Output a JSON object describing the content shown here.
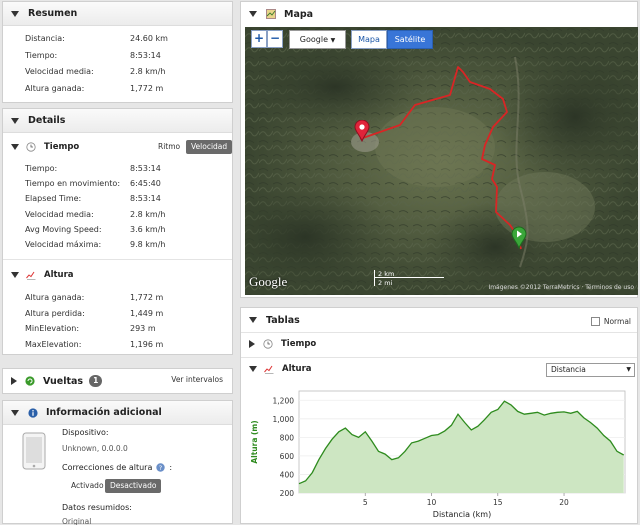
{
  "summary": {
    "title": "Resumen",
    "rows": [
      {
        "label": "Distancia:",
        "value": "24.60 km"
      },
      {
        "label": "Tiempo:",
        "value": "8:53:14"
      },
      {
        "label": "Velocidad media:",
        "value": "2.8 km/h"
      },
      {
        "label": "Altura ganada:",
        "value": "1,772 m"
      }
    ]
  },
  "details": {
    "title": "Details",
    "time_section": {
      "title": "Tiempo",
      "toggle_pace": "Ritmo",
      "toggle_speed": "Velocidad",
      "rows": [
        {
          "label": "Tiempo:",
          "value": "8:53:14"
        },
        {
          "label": "Tiempo en movimiento:",
          "value": "6:45:40"
        },
        {
          "label": "Elapsed Time:",
          "value": "8:53:14"
        },
        {
          "label": "Velocidad media:",
          "value": "2.8 km/h"
        },
        {
          "label": "Avg Moving Speed:",
          "value": "3.6 km/h"
        },
        {
          "label": "Velocidad máxima:",
          "value": "9.8 km/h"
        }
      ]
    },
    "altitude_section": {
      "title": "Altura",
      "rows": [
        {
          "label": "Altura ganada:",
          "value": "1,772 m"
        },
        {
          "label": "Altura perdida:",
          "value": "1,449 m"
        },
        {
          "label": "MinElevation:",
          "value": "293 m"
        },
        {
          "label": "MaxElevation:",
          "value": "1,196 m"
        }
      ]
    }
  },
  "laps": {
    "title": "Vueltas",
    "count": "1",
    "link": "Ver intervalos"
  },
  "extra": {
    "title": "Información adicional",
    "device_label": "Dispositivo:",
    "device_value": "Unknown, 0.0.0.0",
    "corrections_label": "Correcciones de altura",
    "corrections_suffix": ":",
    "toggle_on": "Activado",
    "toggle_off": "Desactivado",
    "summary_label": "Datos resumidos:",
    "summary_value": "Original"
  },
  "map": {
    "title": "Mapa",
    "zoom_in": "+",
    "zoom_out": "−",
    "provider": "Google",
    "type_map": "Mapa",
    "type_satellite": "Satélite",
    "scale_km": "2 km",
    "scale_mi": "2 mi",
    "logo": "Google",
    "attribution": "Imágenes ©2012 TerraMetrics · Términos de uso"
  },
  "tables": {
    "title": "Tablas",
    "normal_label": "Normal",
    "time_title": "Tiempo",
    "alt_title": "Altura",
    "x_select": "Distancia"
  },
  "chart_data": {
    "type": "area",
    "xlabel": "Distancia (km)",
    "ylabel": "Altura (m)",
    "xlim": [
      0,
      24.6
    ],
    "ylim": [
      200,
      1300
    ],
    "xticks": [
      5,
      10,
      15,
      20
    ],
    "yticks": [
      200,
      400,
      600,
      800,
      1000,
      1200
    ],
    "ytick_labels": [
      "200",
      "400",
      "600",
      "800",
      "1,000",
      "1,200"
    ],
    "colors": {
      "line": "#2e8b1e",
      "fill": "#cde6c2"
    },
    "x": [
      0,
      0.5,
      1,
      1.5,
      2,
      2.5,
      3,
      3.5,
      4,
      4.5,
      5,
      5.5,
      6,
      6.5,
      7,
      7.5,
      8,
      8.5,
      9,
      9.5,
      10,
      10.5,
      11,
      11.5,
      12,
      12.5,
      13,
      13.5,
      14,
      14.5,
      15,
      15.5,
      16,
      16.5,
      17,
      17.5,
      18,
      18.5,
      19,
      19.5,
      20,
      20.5,
      21,
      21.5,
      22,
      22.5,
      23,
      23.5,
      24,
      24.5
    ],
    "y": [
      300,
      330,
      420,
      560,
      680,
      780,
      860,
      900,
      830,
      800,
      860,
      760,
      650,
      620,
      560,
      580,
      650,
      740,
      760,
      790,
      820,
      830,
      870,
      930,
      1050,
      960,
      880,
      920,
      990,
      1070,
      1100,
      1190,
      1150,
      1080,
      1050,
      1060,
      1070,
      1040,
      1060,
      1070,
      1075,
      1060,
      1080,
      1010,
      960,
      900,
      820,
      760,
      650,
      610
    ]
  }
}
